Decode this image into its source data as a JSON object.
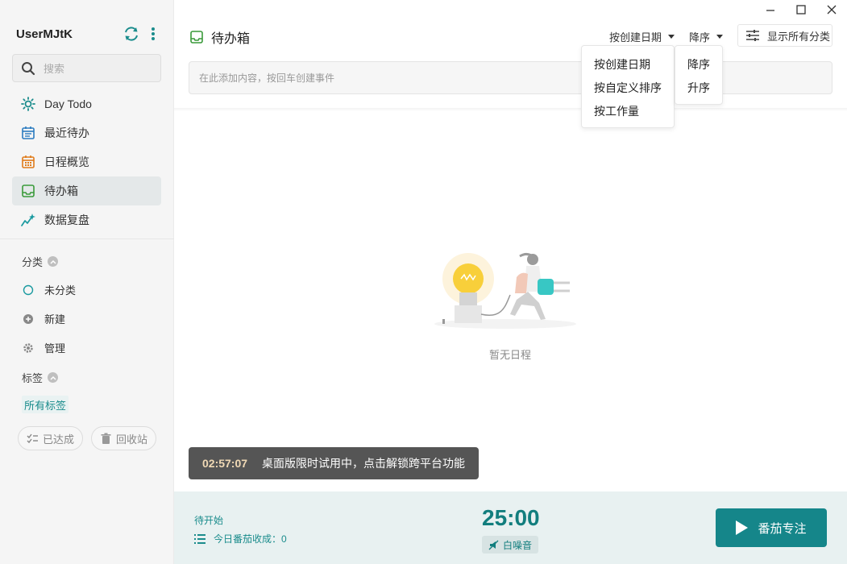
{
  "sidebar": {
    "username": "UserMJtK",
    "search_placeholder": "搜索",
    "nav": [
      {
        "label": "Day Todo",
        "icon": "sun-icon"
      },
      {
        "label": "最近待办",
        "icon": "calendar-list-icon"
      },
      {
        "label": "日程概览",
        "icon": "calendar-grid-icon"
      },
      {
        "label": "待办箱",
        "icon": "inbox-icon",
        "active": true
      },
      {
        "label": "数据复盘",
        "icon": "chart-sparkle-icon"
      }
    ],
    "category_title": "分类",
    "categories": [
      {
        "label": "未分类",
        "icon": "circle-outline-icon"
      },
      {
        "label": "新建",
        "icon": "plus-circle-icon"
      },
      {
        "label": "管理",
        "icon": "gear-icon"
      }
    ],
    "tag_title": "标签",
    "all_tags": "所有标签",
    "done_btn": "已达成",
    "trash_btn": "回收站"
  },
  "header": {
    "title": "待办箱",
    "sort_by": "按创建日期",
    "order": "降序",
    "show_all": "显示所有分类"
  },
  "add_input": {
    "placeholder": "在此添加内容，按回车创建事件"
  },
  "sort_menu": {
    "options": [
      "按创建日期",
      "按自定义排序",
      "按工作量"
    ]
  },
  "order_menu": {
    "options": [
      "降序",
      "升序"
    ]
  },
  "empty": {
    "text": "暂无日程"
  },
  "toast": {
    "timer": "02:57:07",
    "message": "桌面版限时试用中，点击解锁跨平台功能"
  },
  "footer": {
    "status": "待开始",
    "count": "今日番茄收成：0",
    "time": "25:00",
    "noise": "白噪音",
    "focus_btn": "番茄专注"
  },
  "colors": {
    "accent": "#15868a",
    "sidebar_bg": "#f5f5f5",
    "footer_bg": "#e8f1f1"
  }
}
